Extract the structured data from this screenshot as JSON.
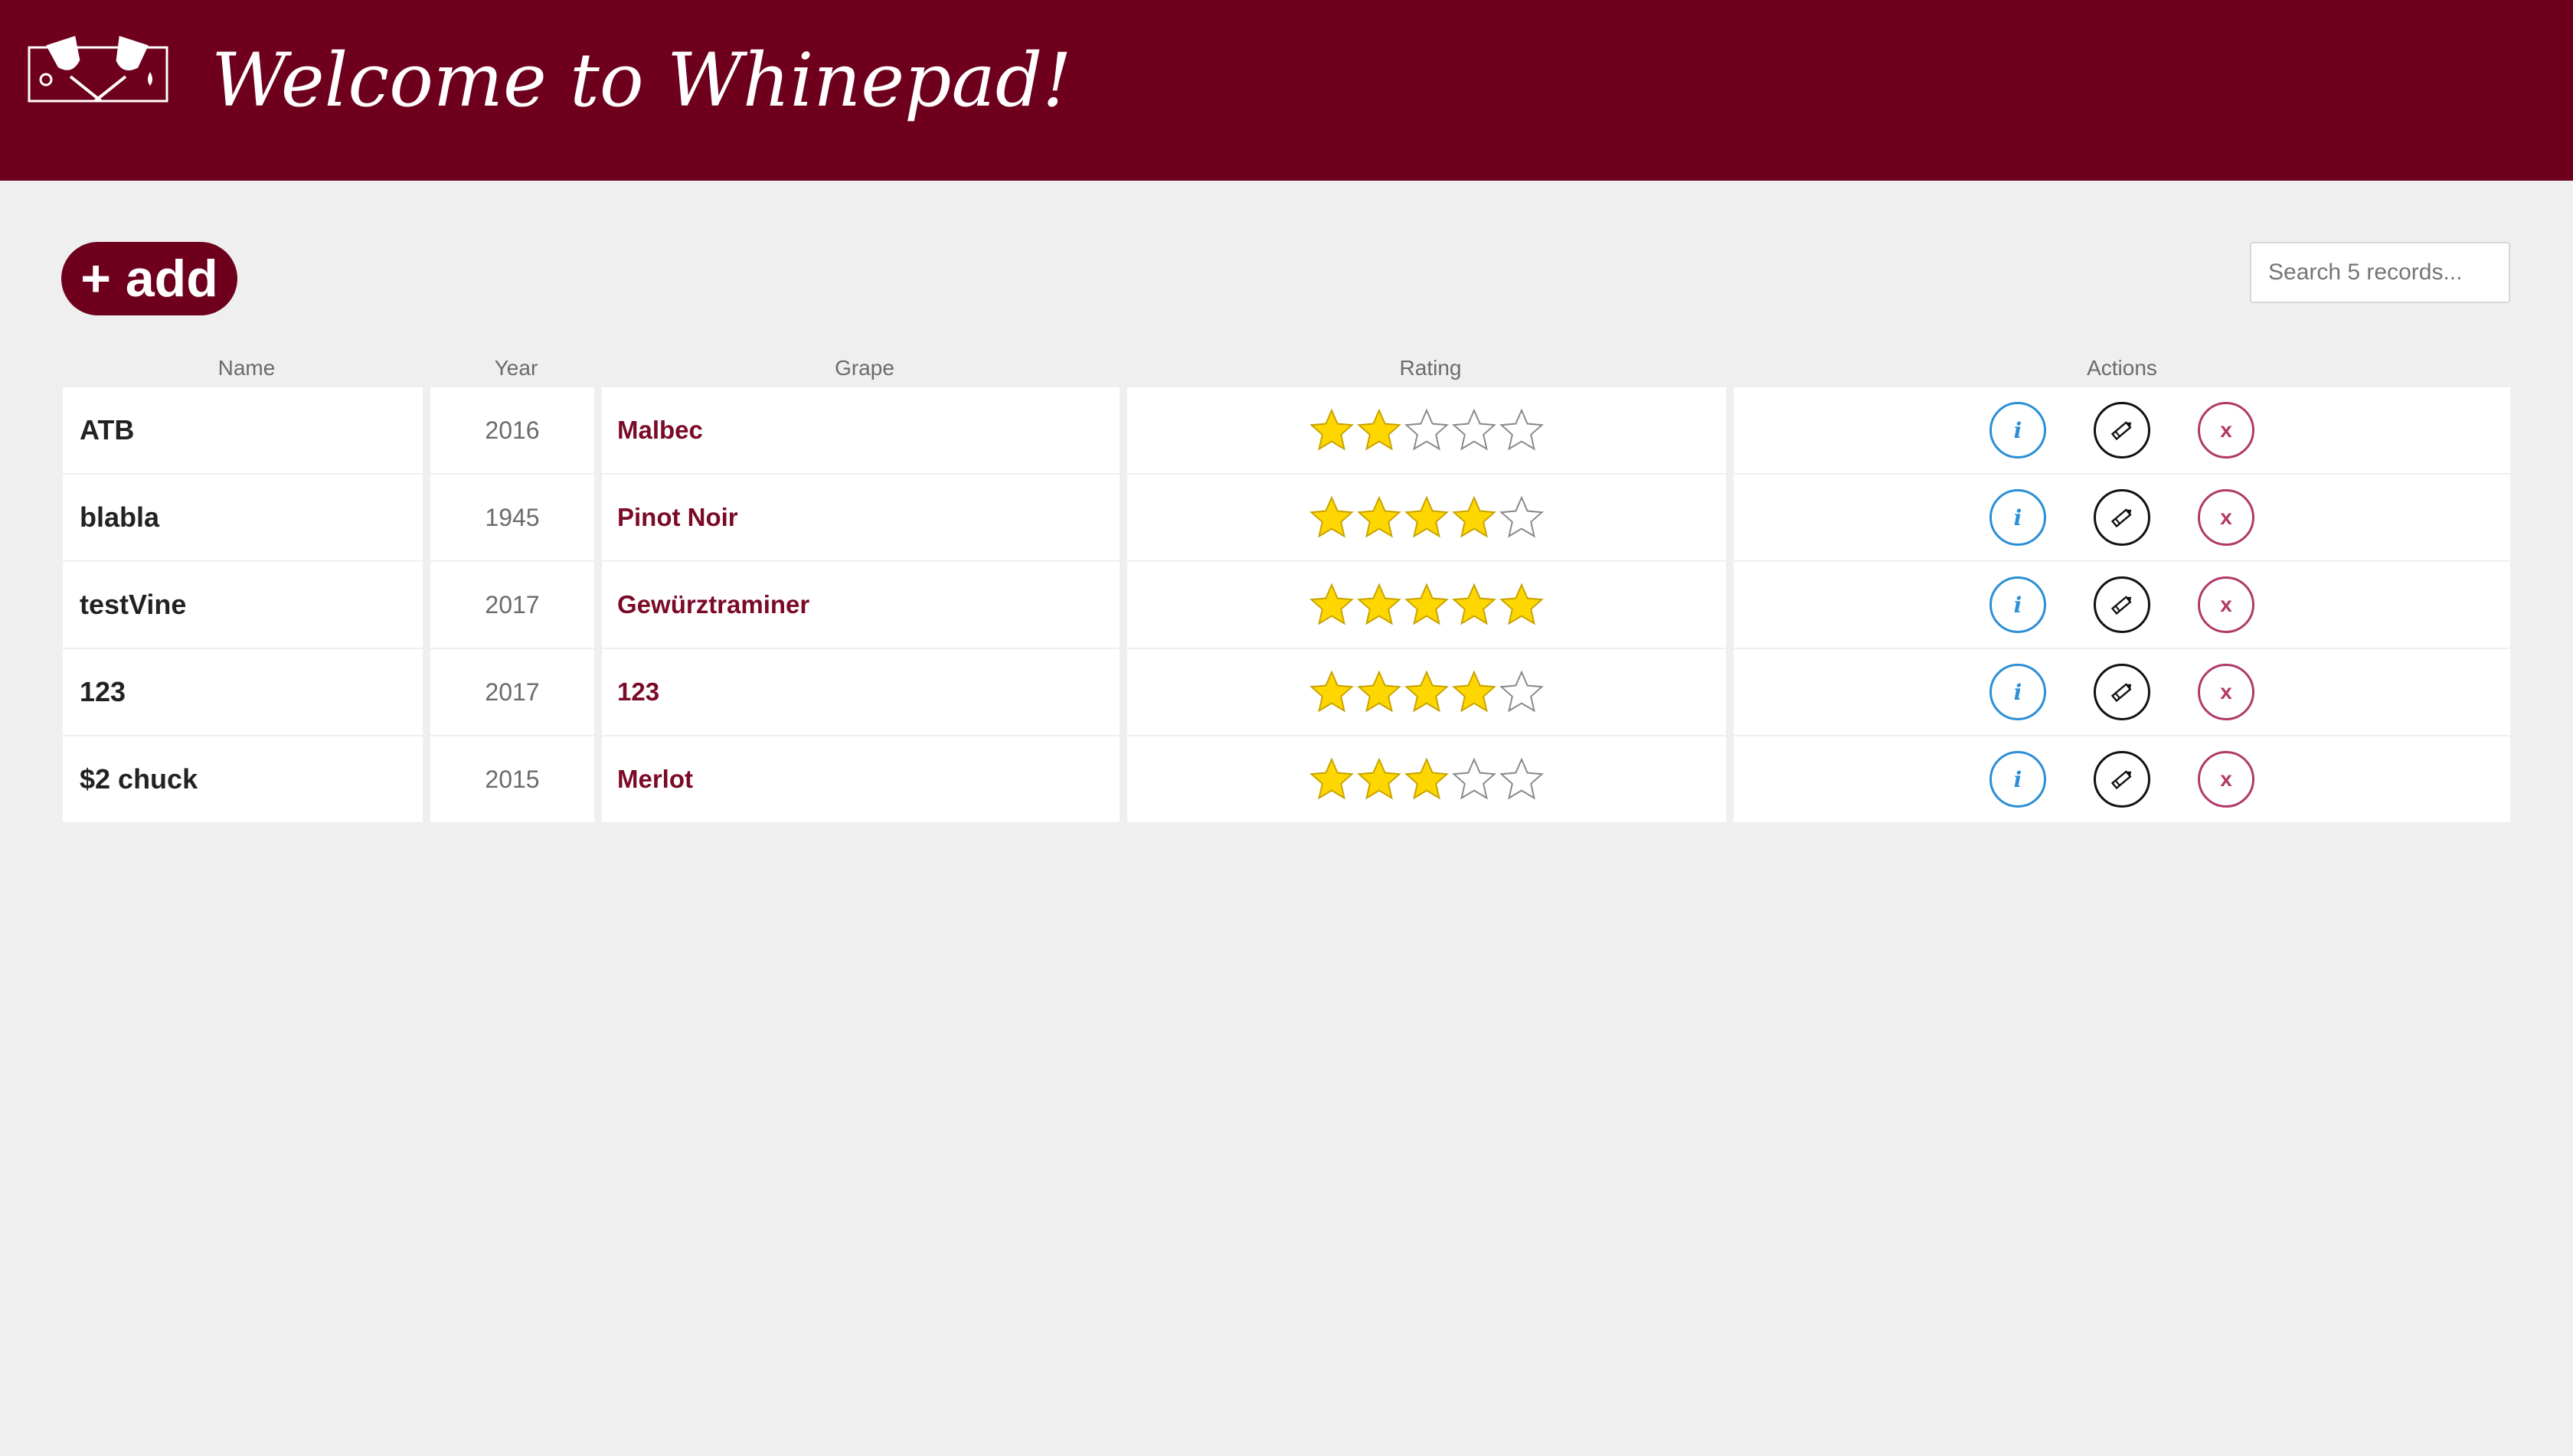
{
  "header": {
    "title": "Welcome to Whinepad!",
    "logo_icon": "wine-glasses-logo-icon",
    "background": "#6e001d"
  },
  "toolbar": {
    "add_label": "+ add",
    "search_placeholder": "Search 5 records..."
  },
  "table": {
    "headers": [
      "Name",
      "Year",
      "Grape",
      "Rating",
      "Actions"
    ],
    "max_rating": 5,
    "rows": [
      {
        "name": "ATB",
        "year": "2016",
        "grape": "Malbec",
        "rating": 2
      },
      {
        "name": "blabla",
        "year": "1945",
        "grape": "Pinot Noir",
        "rating": 4
      },
      {
        "name": "testVine",
        "year": "2017",
        "grape": "Gewürztraminer",
        "rating": 5
      },
      {
        "name": "123",
        "year": "2017",
        "grape": "123",
        "rating": 4
      },
      {
        "name": "$2 chuck",
        "year": "2015",
        "grape": "Merlot",
        "rating": 3
      }
    ],
    "actions": {
      "info_label": "i",
      "edit_icon": "pencil-icon",
      "delete_label": "x"
    }
  },
  "colors": {
    "accent": "#6e001d",
    "grape_text": "#7a0a26",
    "star_filled": "#ffd700",
    "info": "#2b8fd6",
    "delete": "#b03a68"
  }
}
